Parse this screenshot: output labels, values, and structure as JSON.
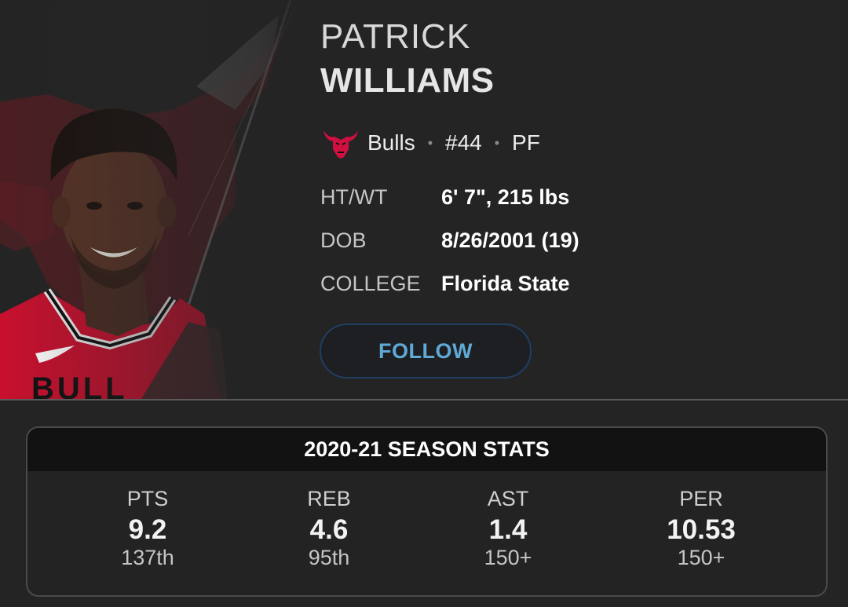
{
  "player": {
    "first_name": "PATRICK",
    "last_name": "WILLIAMS",
    "team": "Bulls",
    "number": "#44",
    "position": "PF",
    "team_logo_icon": "bulls-logo-icon",
    "photo": "player-headshot"
  },
  "info": [
    {
      "label": "HT/WT",
      "value": "6' 7\", 215 lbs"
    },
    {
      "label": "DOB",
      "value": "8/26/2001 (19)"
    },
    {
      "label": "COLLEGE",
      "value": "Florida State"
    }
  ],
  "follow_label": "FOLLOW",
  "stats": {
    "title": "2020-21 SEASON STATS",
    "items": [
      {
        "label": "PTS",
        "value": "9.2",
        "rank": "137th"
      },
      {
        "label": "REB",
        "value": "4.6",
        "rank": "95th"
      },
      {
        "label": "AST",
        "value": "1.4",
        "rank": "150+"
      },
      {
        "label": "PER",
        "value": "10.53",
        "rank": "150+"
      }
    ]
  },
  "colors": {
    "background": "#242424",
    "accent": "#5fa9d6",
    "team_red": "#ce1141"
  }
}
